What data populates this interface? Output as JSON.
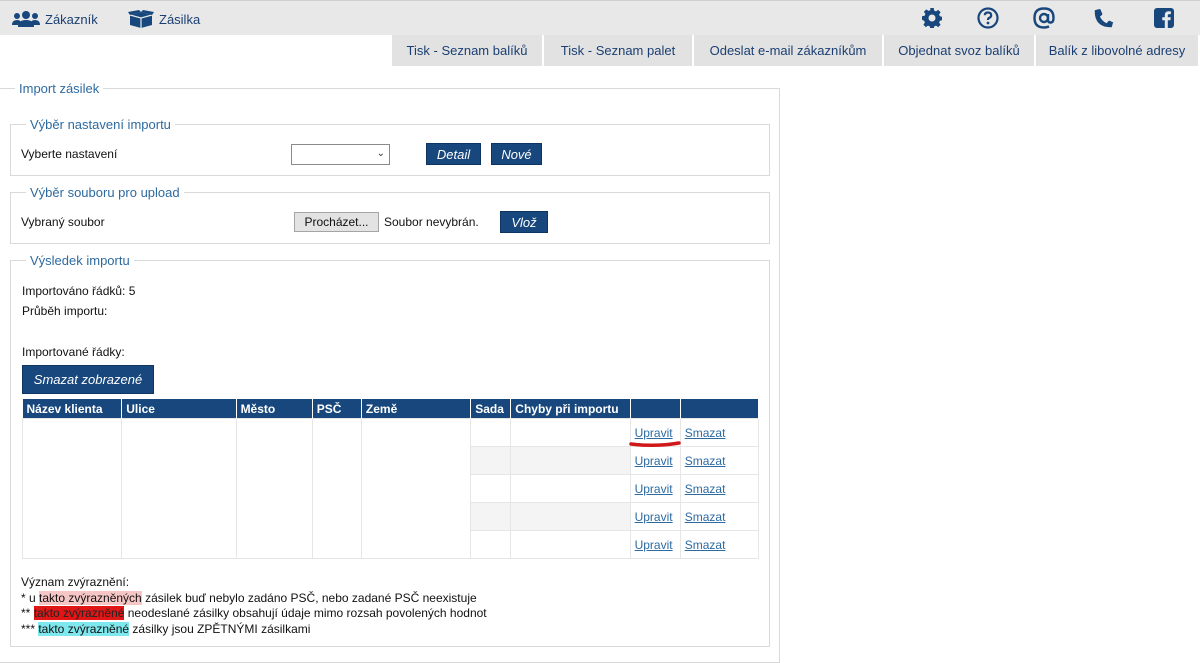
{
  "topnav": {
    "customer_label": "Zákazník",
    "shipment_label": "Zásilka"
  },
  "icons": [
    "gear-icon",
    "question-icon",
    "at-icon",
    "phone-icon",
    "facebook-icon"
  ],
  "subtabs": [
    "Tisk - Seznam balíků",
    "Tisk - Seznam palet",
    "Odeslat e-mail zákazníkům",
    "Objednat svoz balíků",
    "Balík z libovolné adresy"
  ],
  "import": {
    "title": "Import zásilek",
    "settings": {
      "legend": "Výběr nastavení importu",
      "label": "Vyberte nastavení",
      "select_value": "",
      "detail_label": "Detail",
      "new_label": "Nové"
    },
    "upload": {
      "legend": "Výběr souboru pro upload",
      "label": "Vybraný soubor",
      "browse_label": "Procházet...",
      "file_status": "Soubor nevybrán.",
      "insert_label": "Vlož"
    },
    "result": {
      "legend": "Výsledek importu",
      "rows_imported": "Importováno řádků: 5",
      "progress": "Průběh importu:",
      "rows_label": "Importované řádky:",
      "delete_shown_label": "Smazat zobrazené",
      "columns": [
        "Název klienta",
        "Ulice",
        "Město",
        "PSČ",
        "Země",
        "Sada",
        "Chyby při importu",
        "",
        ""
      ],
      "rows": [
        {
          "edit": "Upravit",
          "delete": "Smazat"
        },
        {
          "edit": "Upravit",
          "delete": "Smazat"
        },
        {
          "edit": "Upravit",
          "delete": "Smazat"
        },
        {
          "edit": "Upravit",
          "delete": "Smazat"
        },
        {
          "edit": "Upravit",
          "delete": "Smazat"
        }
      ]
    },
    "legend_notes": {
      "title": "Význam zvýraznění:",
      "l1_prefix": "* u ",
      "l1_hl": "takto zvýrazněných",
      "l1_suffix": " zásilek buď nebylo zadáno PSČ, nebo zadané PSČ neexistuje",
      "l2_prefix": "** ",
      "l2_hl": "takto zvýrazněné",
      "l2_suffix": " neodeslané zásilky obsahují údaje mimo rozsah povolených hodnot",
      "l3_prefix": "*** ",
      "l3_hl": "takto zvýrazněné",
      "l3_suffix": " zásilky jsou ZPĚTNÝMI zásilkami"
    }
  },
  "colors": {
    "primary": "#17477c",
    "link": "#2d6aa0",
    "annotation": "#d01818",
    "pink": "#f6c6c6",
    "red": "#e01616",
    "cyan": "#7ee8ee"
  }
}
